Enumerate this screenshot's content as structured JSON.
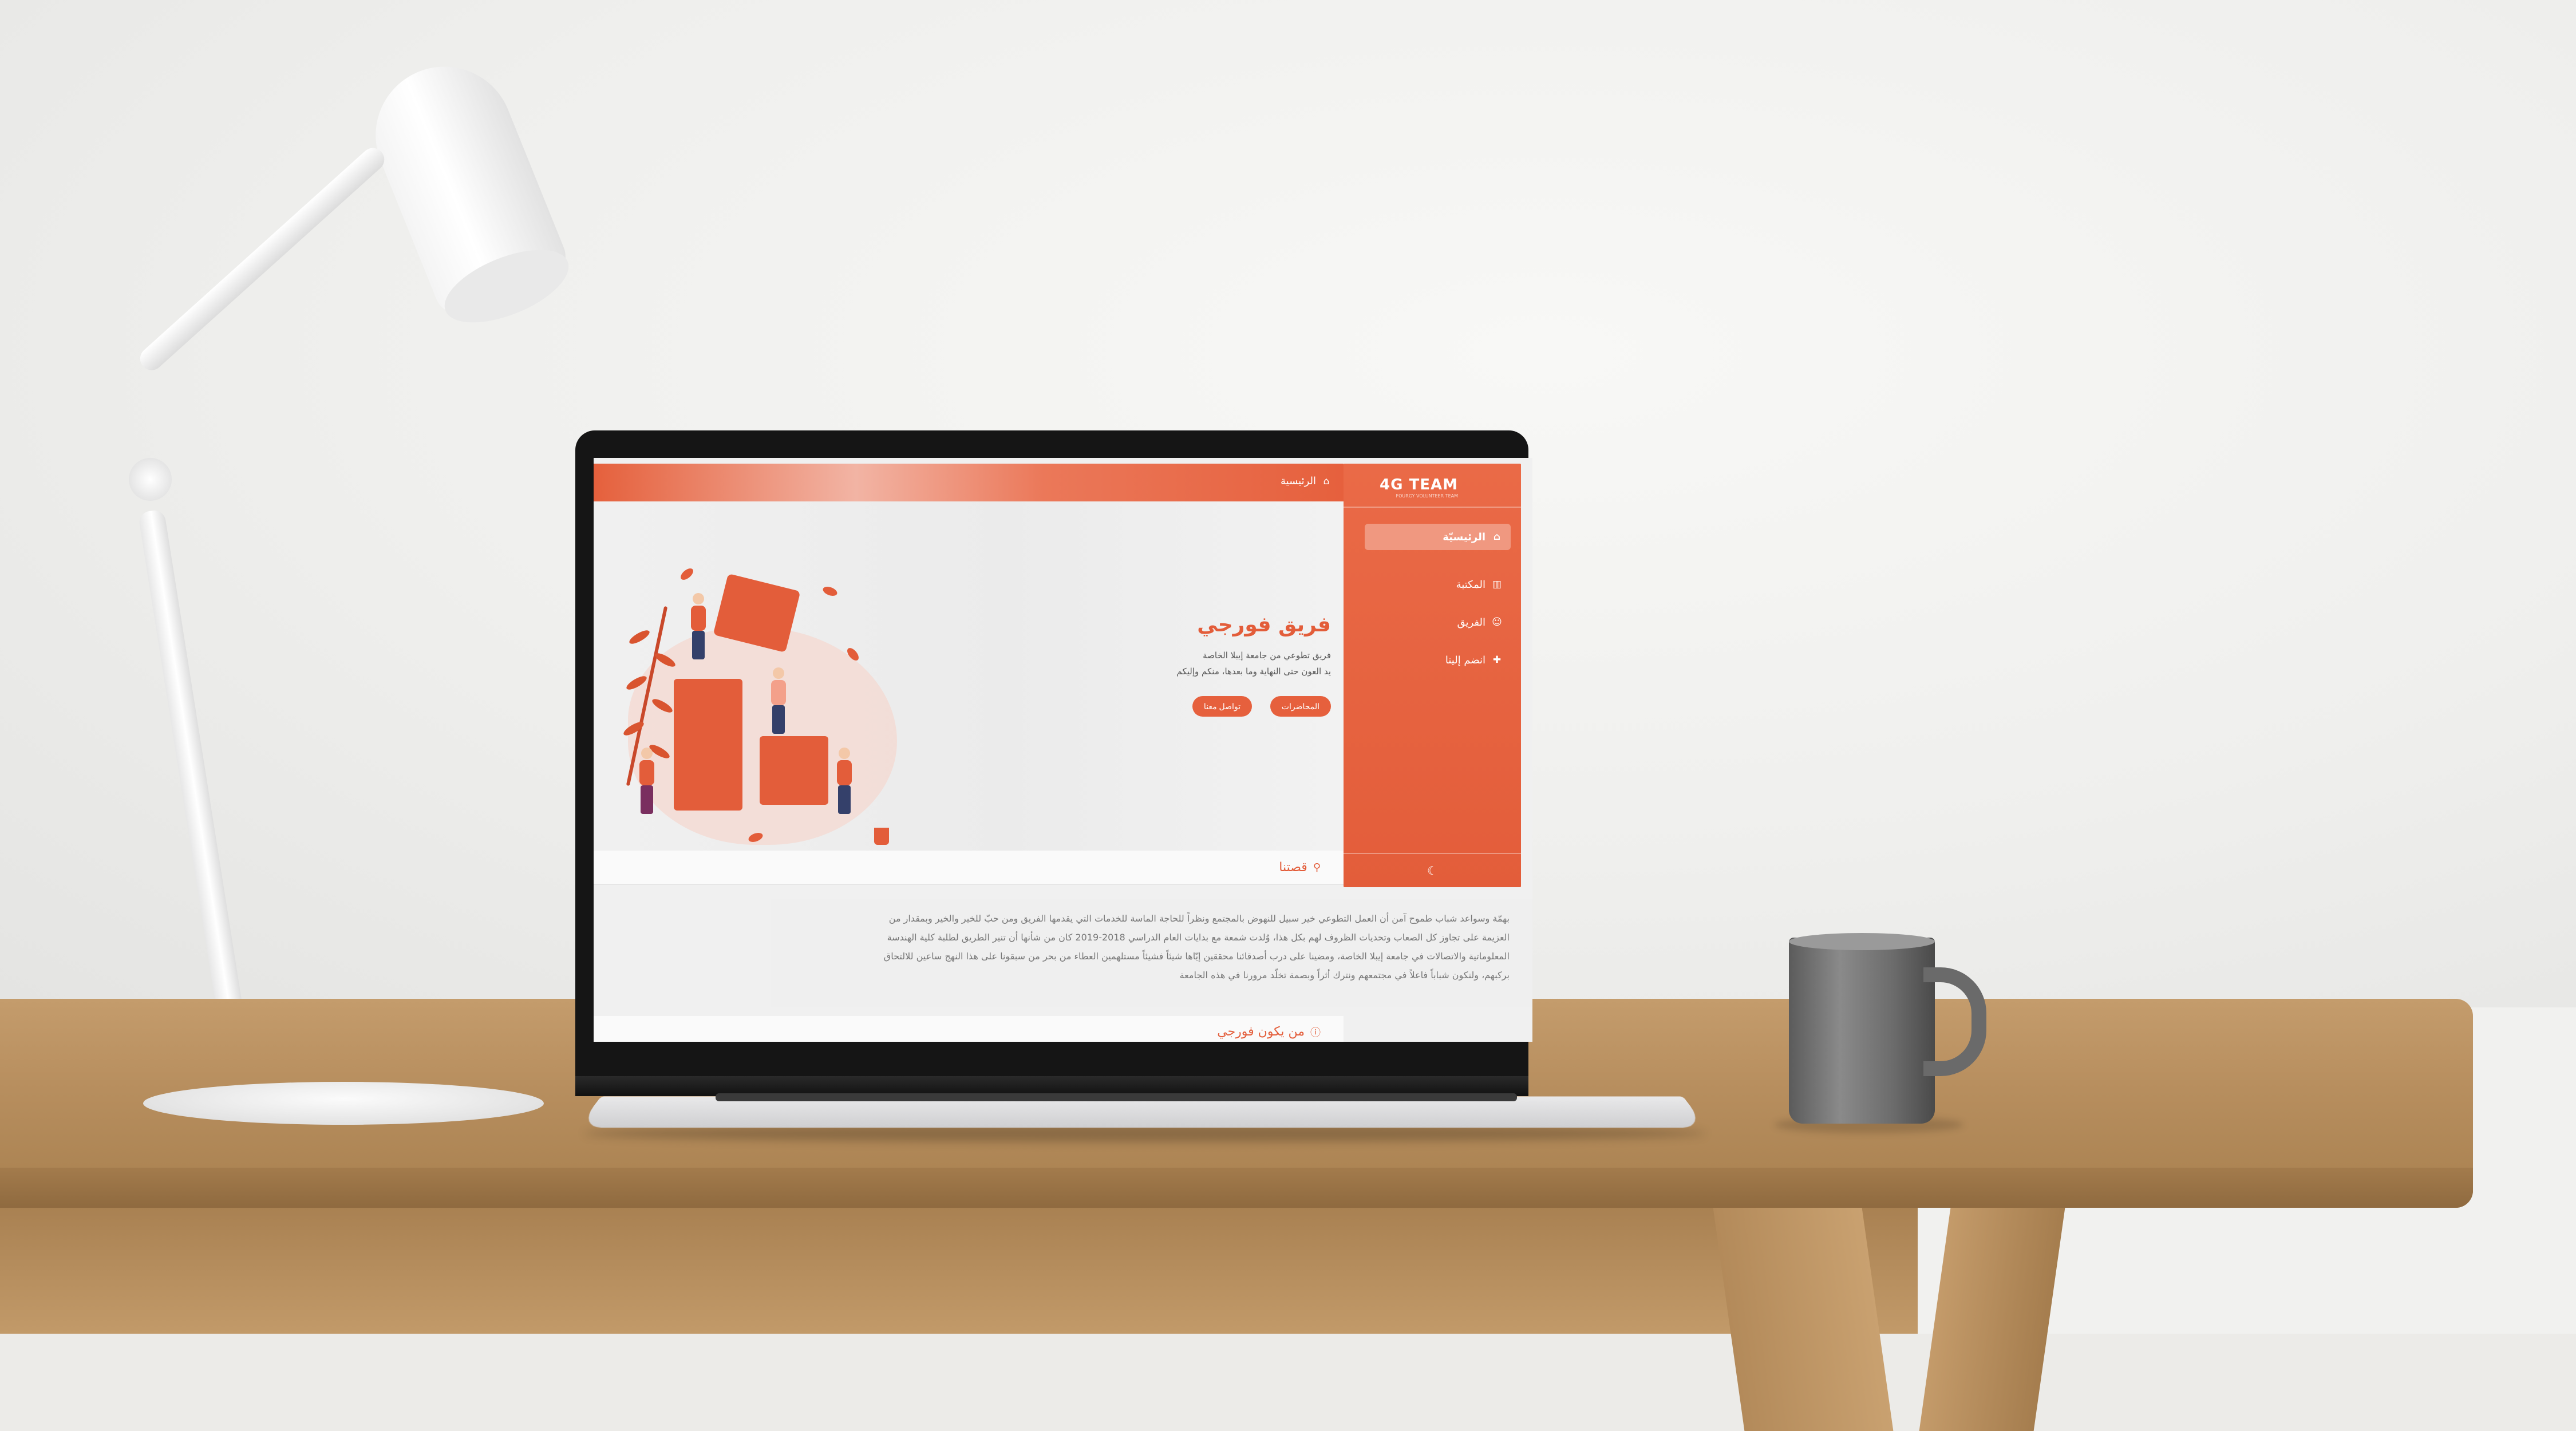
{
  "app": {
    "logo": "4G TEAM",
    "logo_sub": "FOURGY VOLUNTEER TEAM",
    "accent": "#e35d3a"
  },
  "sidebar": {
    "items": [
      {
        "label": "الرئيسيّة",
        "icon": "home-icon",
        "active": true
      },
      {
        "label": "المكتبة",
        "icon": "library-icon",
        "active": false
      },
      {
        "label": "الفريق",
        "icon": "team-icon",
        "active": false
      },
      {
        "label": "انضم إلينا",
        "icon": "user-plus-icon",
        "active": false
      }
    ],
    "footer_icon": "moon-icon"
  },
  "topbar": {
    "breadcrumb": "الرئيسية",
    "icon": "home-icon"
  },
  "hero": {
    "title": "فريق فورجي",
    "line1": "فريق تطوعي من جامعة إيبلا الخاصة",
    "line2": "يد العون حتى النهاية وما بعدها، منكم وإليكم",
    "btn_lectures": "المحاضرات",
    "btn_contact": "تواصل معنا"
  },
  "story": {
    "title": "قصتنا",
    "lines": [
      "بهمّة وسواعد شباب طموح آمن أن العمل التطوعي خير سبيل للنهوض بالمجتمع ونظراً للحاجة الماسة للخدمات التي يقدمها الفريق ومن حبّ للخير والخير وبمقدار من",
      "العزيمة على تجاوز كل الصعاب وتحديات الظروف لهم بكل هذا، وُلدت شمعة مع بدايات العام الدراسي 2018-2019 كان من شأنها أن تنير الطريق لطلبة كلية الهندسة",
      "المعلوماتية والاتصالات في جامعة إيبلا الخاصة، ومضينا على درب أصدقائنا محققين إيّاها شيئاً فشيئاً مستلهمين العطاء من بحر من سبقونا على هذا النهج ساعين للالتحاق",
      "بركبهم، ولنكون شباباً فاعلاً في مجتمعهم ونترك أثراً وبصمة تخلّد مرورنا في هذه الجامعة"
    ]
  },
  "who": {
    "title": "من يكون فورجي"
  }
}
